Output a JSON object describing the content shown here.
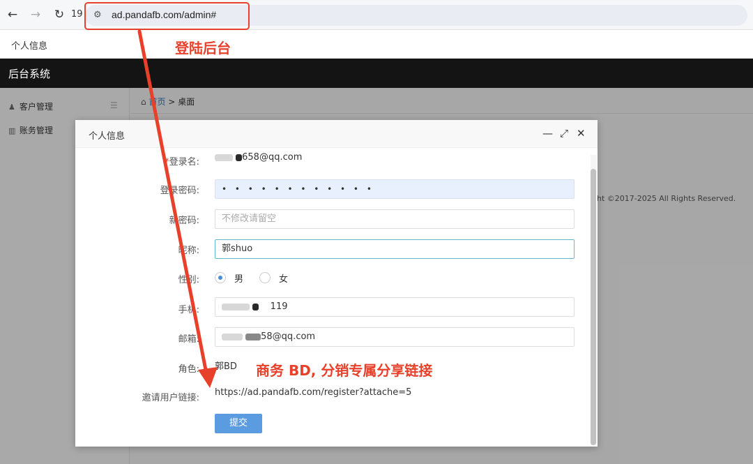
{
  "browser": {
    "back_icon": "arrow-left-icon",
    "forward_icon": "arrow-right-icon",
    "reload_icon": "reload-icon",
    "tab_count": "19",
    "site_icon": "site-settings-icon",
    "url": "ad.pandafb.com/admin#"
  },
  "app_tabbar": {
    "tab_label": "个人信息"
  },
  "header": {
    "title": "后台系统"
  },
  "sidebar": {
    "items": [
      {
        "label": "客户管理",
        "icon": "user-icon"
      },
      {
        "label": "账务管理",
        "icon": "chart-icon"
      }
    ],
    "menu_icon": "hamburger-icon"
  },
  "breadcrumb": {
    "home": "首页",
    "separator": ">",
    "current": "桌面"
  },
  "footer": {
    "copyright": "ght ©2017-2025 All Rights Reserved."
  },
  "modal": {
    "title": "个人信息",
    "fields": {
      "login_name": {
        "label_req": "*",
        "label": "登录名:",
        "value": "658@qq.com"
      },
      "password": {
        "label": "登录密码:",
        "value": "• • • • • • • • • • • •"
      },
      "new_password": {
        "label": "新密码:",
        "placeholder": "不修改请留空"
      },
      "nickname": {
        "label": "昵称:",
        "value": "郭shuo"
      },
      "gender": {
        "label": "性别:",
        "options": [
          "男",
          "女"
        ],
        "selected": "男"
      },
      "phone": {
        "label": "手机:",
        "value": "119"
      },
      "email": {
        "label": "邮箱:",
        "value": "58@qq.com"
      },
      "role": {
        "label": "角色:",
        "value": "郭BD"
      },
      "invite": {
        "label": "邀请用户链接:",
        "value": "https://ad.pandafb.com/register?attache=5"
      }
    },
    "submit_label": "提交"
  },
  "annotations": {
    "login_note": "登陆后台",
    "share_note": "商务 BD, 分销专属分享链接",
    "color": "#e8412b"
  }
}
